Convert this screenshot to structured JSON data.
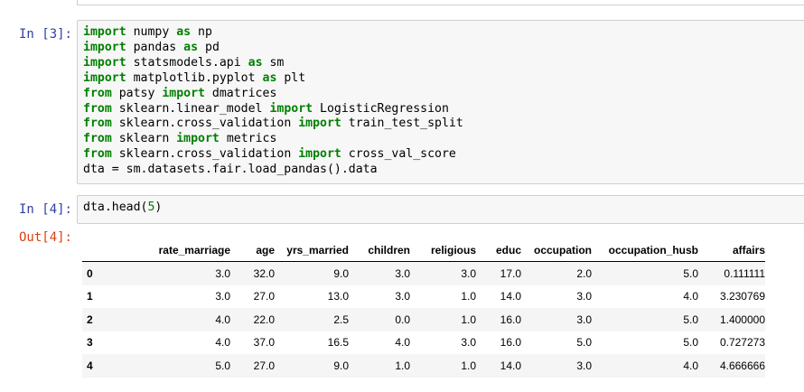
{
  "cell3": {
    "prompt": "In [3]:",
    "lines": [
      [
        {
          "t": "import",
          "k": true
        },
        {
          "t": " numpy "
        },
        {
          "t": "as",
          "k": true
        },
        {
          "t": " np"
        }
      ],
      [
        {
          "t": "import",
          "k": true
        },
        {
          "t": " pandas "
        },
        {
          "t": "as",
          "k": true
        },
        {
          "t": " pd"
        }
      ],
      [
        {
          "t": "import",
          "k": true
        },
        {
          "t": " statsmodels.api "
        },
        {
          "t": "as",
          "k": true
        },
        {
          "t": " sm"
        }
      ],
      [
        {
          "t": "import",
          "k": true
        },
        {
          "t": " matplotlib.pyplot "
        },
        {
          "t": "as",
          "k": true
        },
        {
          "t": " plt"
        }
      ],
      [
        {
          "t": "from",
          "k": true
        },
        {
          "t": " patsy "
        },
        {
          "t": "import",
          "k": true
        },
        {
          "t": " dmatrices"
        }
      ],
      [
        {
          "t": "from",
          "k": true
        },
        {
          "t": " sklearn.linear_model "
        },
        {
          "t": "import",
          "k": true
        },
        {
          "t": " LogisticRegression"
        }
      ],
      [
        {
          "t": "from",
          "k": true
        },
        {
          "t": " sklearn.cross_validation "
        },
        {
          "t": "import",
          "k": true
        },
        {
          "t": " train_test_split"
        }
      ],
      [
        {
          "t": "from",
          "k": true
        },
        {
          "t": " sklearn "
        },
        {
          "t": "import",
          "k": true
        },
        {
          "t": " metrics"
        }
      ],
      [
        {
          "t": "from",
          "k": true
        },
        {
          "t": " sklearn.cross_validation "
        },
        {
          "t": "import",
          "k": true
        },
        {
          "t": " cross_val_score"
        }
      ],
      [
        {
          "t": "dta = sm.datasets.fair.load_pandas().data"
        }
      ]
    ]
  },
  "cell4": {
    "prompt": "In [4]:",
    "code_prefix": "dta.head(",
    "code_num": "5",
    "code_suffix": ")",
    "out_prompt": "Out[4]:"
  },
  "table": {
    "columns": [
      "",
      "rate_marriage",
      "age",
      "yrs_married",
      "children",
      "religious",
      "educ",
      "occupation",
      "occupation_husb",
      "affairs"
    ],
    "rows": [
      [
        "0",
        "3.0",
        "32.0",
        "9.0",
        "3.0",
        "3.0",
        "17.0",
        "2.0",
        "5.0",
        "0.111111"
      ],
      [
        "1",
        "3.0",
        "27.0",
        "13.0",
        "3.0",
        "1.0",
        "14.0",
        "3.0",
        "4.0",
        "3.230769"
      ],
      [
        "2",
        "4.0",
        "22.0",
        "2.5",
        "0.0",
        "1.0",
        "16.0",
        "3.0",
        "5.0",
        "1.400000"
      ],
      [
        "3",
        "4.0",
        "37.0",
        "16.5",
        "4.0",
        "3.0",
        "16.0",
        "5.0",
        "5.0",
        "0.727273"
      ],
      [
        "4",
        "5.0",
        "27.0",
        "9.0",
        "1.0",
        "1.0",
        "14.0",
        "3.0",
        "4.0",
        "4.666666"
      ]
    ]
  },
  "colors": {
    "prompt_in": "#303F9F",
    "prompt_out": "#D84315",
    "keyword": "#008000",
    "input_bg": "#f7f7f7"
  }
}
